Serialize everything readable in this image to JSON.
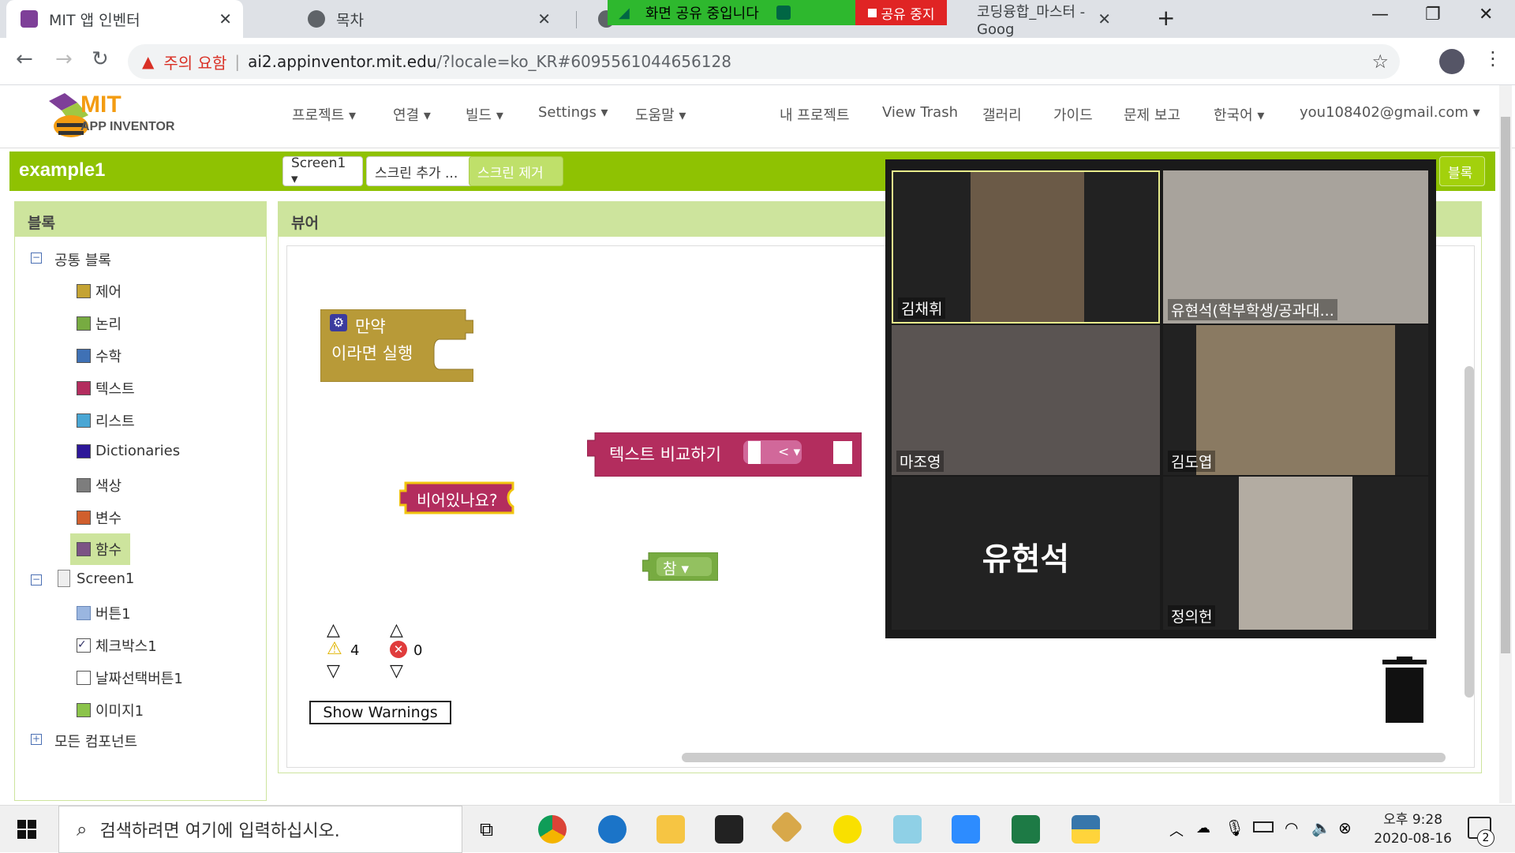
{
  "browser": {
    "tabs": [
      {
        "title": "MIT 앱 인벤터",
        "active": true
      },
      {
        "title": "목차",
        "active": false
      },
      {
        "title": "코딩융합_마스터 - Goog",
        "active": false
      }
    ],
    "new_tab": "+",
    "url_warning": "주의 요함",
    "url_host": "ai2.appinventor.mit.edu",
    "url_rest": "/?locale=ko_KR#6095561044656128"
  },
  "screenshare": {
    "status": "화면 공유 중입니다",
    "stop": "공유 중지"
  },
  "app": {
    "logo_line1": "MIT",
    "logo_line2": "APP INVENTOR",
    "menu": [
      "프로젝트 ▾",
      "연결 ▾",
      "빌드 ▾",
      "Settings ▾",
      "도움말 ▾"
    ],
    "menu_right": [
      "내 프로젝트",
      "View Trash",
      "갤러리",
      "가이드",
      "문제 보고",
      "한국어 ▾",
      "you108402@gmail.com ▾"
    ]
  },
  "project": {
    "name": "example1",
    "screen_select": "Screen1 ▾",
    "add_screen": "스크린 추가 ...",
    "remove_screen": "스크린 제거",
    "blocks_button": "블록"
  },
  "blocks_panel": {
    "title": "블록",
    "builtin_group": "공통 블록",
    "builtin": [
      {
        "label": "제어",
        "color": "#c4a333"
      },
      {
        "label": "논리",
        "color": "#77ab41"
      },
      {
        "label": "수학",
        "color": "#3f71b5"
      },
      {
        "label": "텍스트",
        "color": "#b32d5e"
      },
      {
        "label": "리스트",
        "color": "#49a6d4"
      },
      {
        "label": "Dictionaries",
        "color": "#2d1799"
      },
      {
        "label": "색상",
        "color": "#7d7d7d"
      },
      {
        "label": "변수",
        "color": "#d05f2d"
      },
      {
        "label": "함수",
        "color": "#7c5385"
      }
    ],
    "screen_group": "Screen1",
    "components": [
      "버튼1",
      "체크박스1",
      "날짜선택버튼1",
      "이미지1"
    ],
    "all_components": "모든 컴포넌트"
  },
  "viewer": {
    "title": "뷰어",
    "blocks": {
      "if_line1": "만약",
      "if_line2": "이라면 실행",
      "compare": "텍스트 비교하기",
      "compare_op": "< ▾",
      "is_empty": "비어있나요?",
      "true_val": "참 ▾"
    },
    "warnings_count": "4",
    "errors_count": "0",
    "show_warnings": "Show Warnings"
  },
  "zoom": {
    "participants": [
      {
        "name": "김채휘"
      },
      {
        "name": "유현석(학부학생/공과대..."
      },
      {
        "name": "마조영"
      },
      {
        "name": "김도엽"
      },
      {
        "name": "유현석",
        "video_off": true
      },
      {
        "name": "정의헌"
      }
    ]
  },
  "taskbar": {
    "search_placeholder": "검색하려면 여기에 입력하십시오.",
    "time": "오후 9:28",
    "date": "2020-08-16",
    "notifications": "2"
  }
}
